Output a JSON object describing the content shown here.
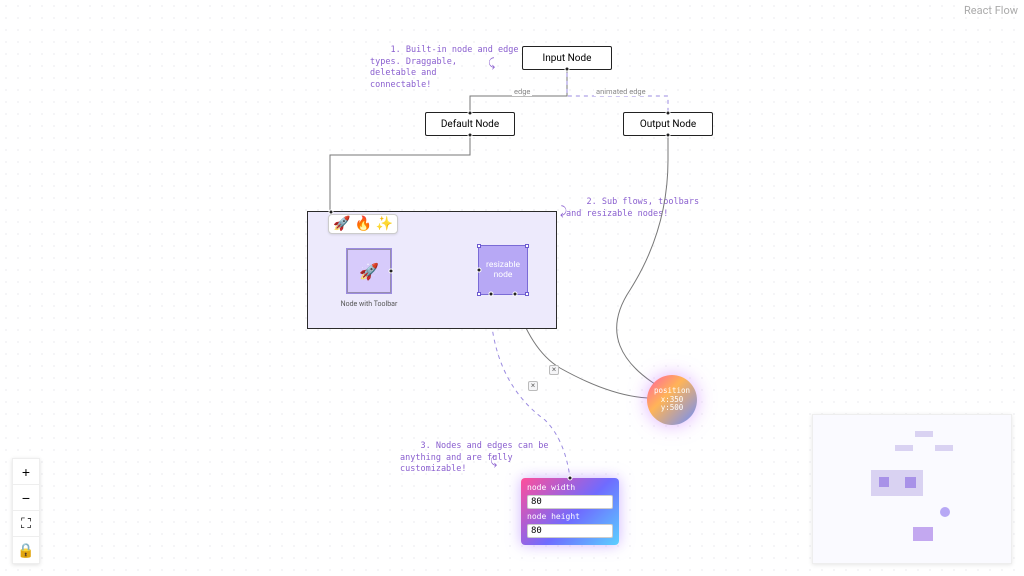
{
  "attribution": "React Flow",
  "annotations": {
    "a1_label": "1.",
    "a1_text": "Built-in node and edge\ntypes. Draggable,\ndeletable and\nconnectable!",
    "a1_arrow": "⤹",
    "a2_label": "2.",
    "a2_text": "Sub flows, toolbars\nand resizable nodes!",
    "a2_arrow": "⤹",
    "a3_label": "3.",
    "a3_text": "Nodes and edges can be\nanything and are fully\ncustomizable!",
    "a3_arrow": "⤹"
  },
  "nodes": {
    "input_label": "Input Node",
    "default_label": "Default Node",
    "output_label": "Output Node",
    "toolbar_icons": {
      "rocket": "🚀",
      "fire": "🔥",
      "sparkle": "✨"
    },
    "toolbar_node_emoji": "🚀",
    "toolbar_caption": "Node with Toolbar",
    "resizable_label": "resizable\nnode",
    "circle": {
      "title": "position",
      "x": "x:350",
      "y": "y:500"
    },
    "form": {
      "width_label": "node width",
      "width_value": "80",
      "height_label": "node height",
      "height_value": "80"
    }
  },
  "edges": {
    "e1_label": "edge",
    "e2_label": "animated edge"
  },
  "controls": {
    "zoom_in": "+",
    "zoom_out": "−",
    "fit": "⛶",
    "lock": "🔒"
  }
}
